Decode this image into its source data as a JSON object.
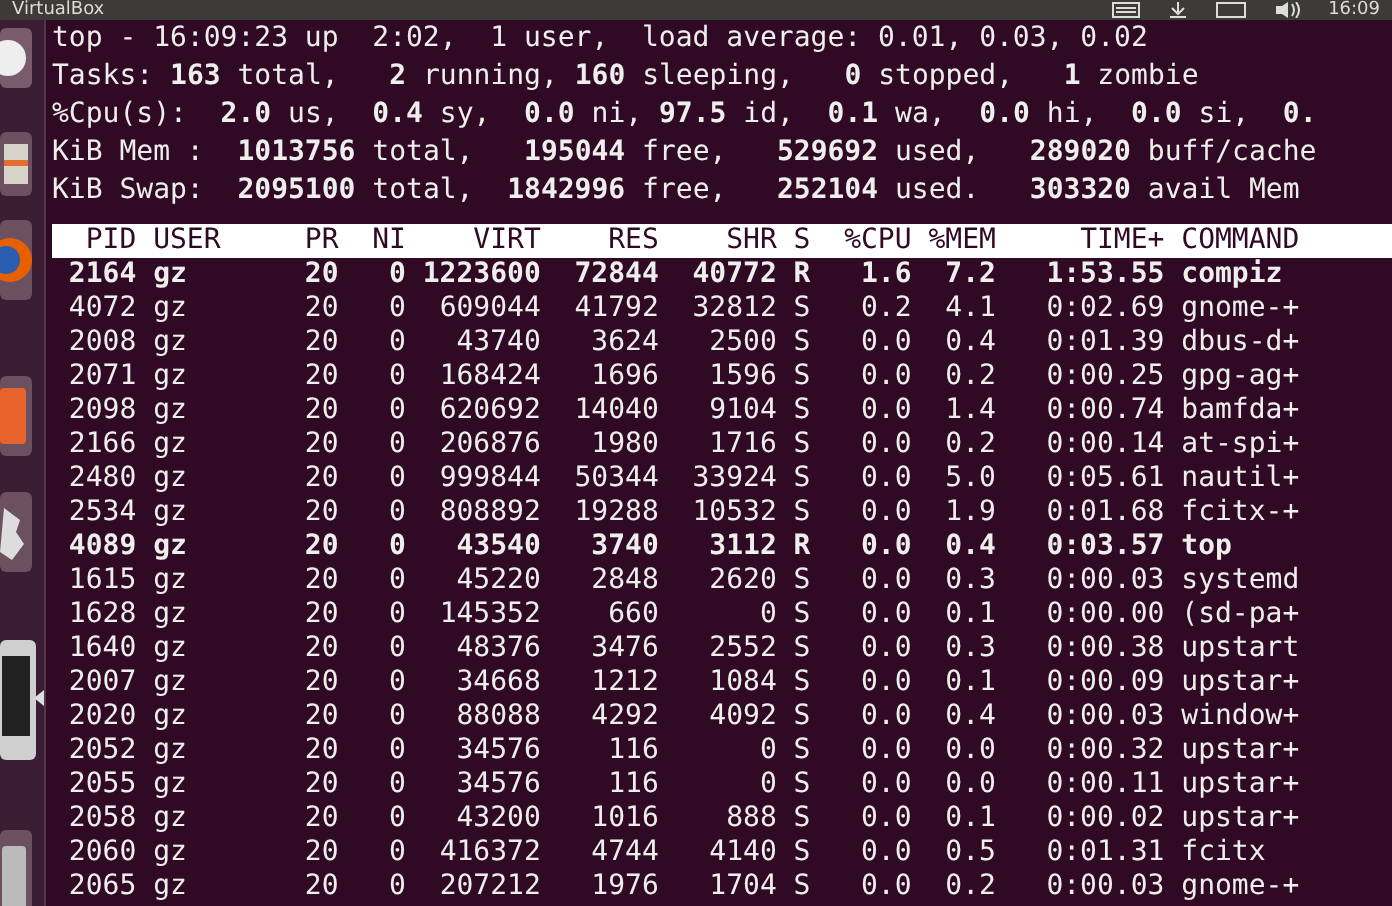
{
  "top_panel": {
    "title": "VirtualBox",
    "clock": "16:09"
  },
  "summary": [
    "top - 16:09:23 up  2:02,  1 user,  load average: 0.01, 0.03, 0.02",
    "Tasks: **163** total,   **2** running, **160** sleeping,   **0** stopped,   **1** zombie",
    "%Cpu(s):  **2.0** us,  **0.4** sy,  **0.0** ni, **97.5** id,  **0.1** wa,  **0.0** hi,  **0.0** si,  **0.**",
    "KiB Mem :  **1013756** total,   **195044** free,   **529692** used,   **289020** buff/cache",
    "KiB Swap:  **2095100** total,  **1842996** free,   **252104** used.   **303320** avail Mem"
  ],
  "table": {
    "columns": [
      "PID",
      "USER",
      "PR",
      "NI",
      "VIRT",
      "RES",
      "SHR",
      "S",
      "%CPU",
      "%MEM",
      "TIME+",
      "COMMAND"
    ],
    "rows": [
      {
        "highlighted": true,
        "cells": [
          "2164",
          "gz",
          "20",
          "0",
          "1223600",
          "72844",
          "40772",
          "R",
          "1.6",
          "7.2",
          "1:53.55",
          "compiz"
        ]
      },
      {
        "highlighted": false,
        "cells": [
          "4072",
          "gz",
          "20",
          "0",
          "609044",
          "41792",
          "32812",
          "S",
          "0.2",
          "4.1",
          "0:02.69",
          "gnome-+"
        ]
      },
      {
        "highlighted": false,
        "cells": [
          "2008",
          "gz",
          "20",
          "0",
          "43740",
          "3624",
          "2500",
          "S",
          "0.0",
          "0.4",
          "0:01.39",
          "dbus-d+"
        ]
      },
      {
        "highlighted": false,
        "cells": [
          "2071",
          "gz",
          "20",
          "0",
          "168424",
          "1696",
          "1596",
          "S",
          "0.0",
          "0.2",
          "0:00.25",
          "gpg-ag+"
        ]
      },
      {
        "highlighted": false,
        "cells": [
          "2098",
          "gz",
          "20",
          "0",
          "620692",
          "14040",
          "9104",
          "S",
          "0.0",
          "1.4",
          "0:00.74",
          "bamfda+"
        ]
      },
      {
        "highlighted": false,
        "cells": [
          "2166",
          "gz",
          "20",
          "0",
          "206876",
          "1980",
          "1716",
          "S",
          "0.0",
          "0.2",
          "0:00.14",
          "at-spi+"
        ]
      },
      {
        "highlighted": false,
        "cells": [
          "2480",
          "gz",
          "20",
          "0",
          "999844",
          "50344",
          "33924",
          "S",
          "0.0",
          "5.0",
          "0:05.61",
          "nautil+"
        ]
      },
      {
        "highlighted": false,
        "cells": [
          "2534",
          "gz",
          "20",
          "0",
          "808892",
          "19288",
          "10532",
          "S",
          "0.0",
          "1.9",
          "0:01.68",
          "fcitx-+"
        ]
      },
      {
        "highlighted": true,
        "cells": [
          "4089",
          "gz",
          "20",
          "0",
          "43540",
          "3740",
          "3112",
          "R",
          "0.0",
          "0.4",
          "0:03.57",
          "top"
        ]
      },
      {
        "highlighted": false,
        "cells": [
          "1615",
          "gz",
          "20",
          "0",
          "45220",
          "2848",
          "2620",
          "S",
          "0.0",
          "0.3",
          "0:00.03",
          "systemd"
        ]
      },
      {
        "highlighted": false,
        "cells": [
          "1628",
          "gz",
          "20",
          "0",
          "145352",
          "660",
          "0",
          "S",
          "0.0",
          "0.1",
          "0:00.00",
          "(sd-pa+"
        ]
      },
      {
        "highlighted": false,
        "cells": [
          "1640",
          "gz",
          "20",
          "0",
          "48376",
          "3476",
          "2552",
          "S",
          "0.0",
          "0.3",
          "0:00.38",
          "upstart"
        ]
      },
      {
        "highlighted": false,
        "cells": [
          "2007",
          "gz",
          "20",
          "0",
          "34668",
          "1212",
          "1084",
          "S",
          "0.0",
          "0.1",
          "0:00.09",
          "upstar+"
        ]
      },
      {
        "highlighted": false,
        "cells": [
          "2020",
          "gz",
          "20",
          "0",
          "88088",
          "4292",
          "4092",
          "S",
          "0.0",
          "0.4",
          "0:00.03",
          "window+"
        ]
      },
      {
        "highlighted": false,
        "cells": [
          "2052",
          "gz",
          "20",
          "0",
          "34576",
          "116",
          "0",
          "S",
          "0.0",
          "0.0",
          "0:00.32",
          "upstar+"
        ]
      },
      {
        "highlighted": false,
        "cells": [
          "2055",
          "gz",
          "20",
          "0",
          "34576",
          "116",
          "0",
          "S",
          "0.0",
          "0.0",
          "0:00.11",
          "upstar+"
        ]
      },
      {
        "highlighted": false,
        "cells": [
          "2058",
          "gz",
          "20",
          "0",
          "43200",
          "1016",
          "888",
          "S",
          "0.0",
          "0.1",
          "0:00.02",
          "upstar+"
        ]
      },
      {
        "highlighted": false,
        "cells": [
          "2060",
          "gz",
          "20",
          "0",
          "416372",
          "4744",
          "4140",
          "S",
          "0.0",
          "0.5",
          "0:01.31",
          "fcitx"
        ]
      },
      {
        "highlighted": false,
        "cells": [
          "2065",
          "gz",
          "20",
          "0",
          "207212",
          "1976",
          "1704",
          "S",
          "0.0",
          "0.2",
          "0:00.03",
          "gnome-+"
        ]
      }
    ]
  }
}
